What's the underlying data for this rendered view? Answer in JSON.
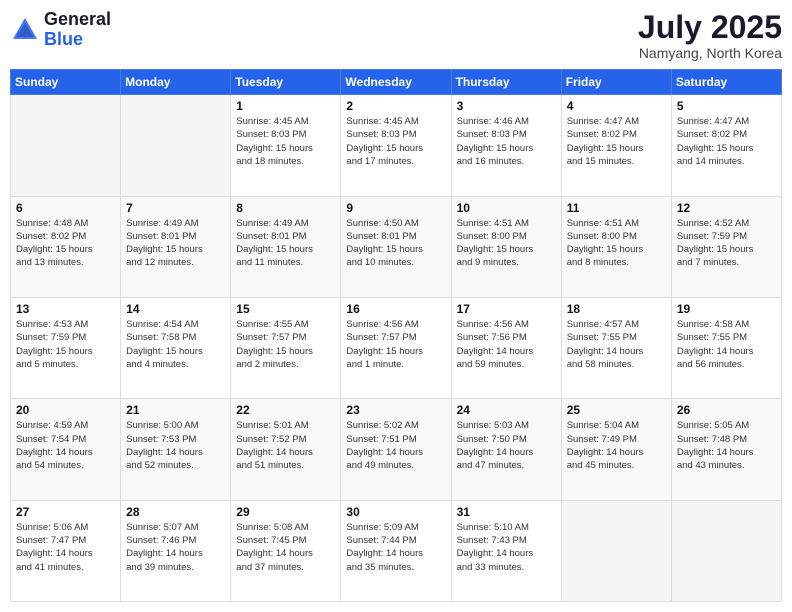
{
  "header": {
    "logo_general": "General",
    "logo_blue": "Blue",
    "month_title": "July 2025",
    "location": "Namyang, North Korea"
  },
  "weekdays": [
    "Sunday",
    "Monday",
    "Tuesday",
    "Wednesday",
    "Thursday",
    "Friday",
    "Saturday"
  ],
  "weeks": [
    [
      {
        "day": "",
        "content": ""
      },
      {
        "day": "",
        "content": ""
      },
      {
        "day": "1",
        "content": "Sunrise: 4:45 AM\nSunset: 8:03 PM\nDaylight: 15 hours\nand 18 minutes."
      },
      {
        "day": "2",
        "content": "Sunrise: 4:45 AM\nSunset: 8:03 PM\nDaylight: 15 hours\nand 17 minutes."
      },
      {
        "day": "3",
        "content": "Sunrise: 4:46 AM\nSunset: 8:03 PM\nDaylight: 15 hours\nand 16 minutes."
      },
      {
        "day": "4",
        "content": "Sunrise: 4:47 AM\nSunset: 8:02 PM\nDaylight: 15 hours\nand 15 minutes."
      },
      {
        "day": "5",
        "content": "Sunrise: 4:47 AM\nSunset: 8:02 PM\nDaylight: 15 hours\nand 14 minutes."
      }
    ],
    [
      {
        "day": "6",
        "content": "Sunrise: 4:48 AM\nSunset: 8:02 PM\nDaylight: 15 hours\nand 13 minutes."
      },
      {
        "day": "7",
        "content": "Sunrise: 4:49 AM\nSunset: 8:01 PM\nDaylight: 15 hours\nand 12 minutes."
      },
      {
        "day": "8",
        "content": "Sunrise: 4:49 AM\nSunset: 8:01 PM\nDaylight: 15 hours\nand 11 minutes."
      },
      {
        "day": "9",
        "content": "Sunrise: 4:50 AM\nSunset: 8:01 PM\nDaylight: 15 hours\nand 10 minutes."
      },
      {
        "day": "10",
        "content": "Sunrise: 4:51 AM\nSunset: 8:00 PM\nDaylight: 15 hours\nand 9 minutes."
      },
      {
        "day": "11",
        "content": "Sunrise: 4:51 AM\nSunset: 8:00 PM\nDaylight: 15 hours\nand 8 minutes."
      },
      {
        "day": "12",
        "content": "Sunrise: 4:52 AM\nSunset: 7:59 PM\nDaylight: 15 hours\nand 7 minutes."
      }
    ],
    [
      {
        "day": "13",
        "content": "Sunrise: 4:53 AM\nSunset: 7:59 PM\nDaylight: 15 hours\nand 5 minutes."
      },
      {
        "day": "14",
        "content": "Sunrise: 4:54 AM\nSunset: 7:58 PM\nDaylight: 15 hours\nand 4 minutes."
      },
      {
        "day": "15",
        "content": "Sunrise: 4:55 AM\nSunset: 7:57 PM\nDaylight: 15 hours\nand 2 minutes."
      },
      {
        "day": "16",
        "content": "Sunrise: 4:56 AM\nSunset: 7:57 PM\nDaylight: 15 hours\nand 1 minute."
      },
      {
        "day": "17",
        "content": "Sunrise: 4:56 AM\nSunset: 7:56 PM\nDaylight: 14 hours\nand 59 minutes."
      },
      {
        "day": "18",
        "content": "Sunrise: 4:57 AM\nSunset: 7:55 PM\nDaylight: 14 hours\nand 58 minutes."
      },
      {
        "day": "19",
        "content": "Sunrise: 4:58 AM\nSunset: 7:55 PM\nDaylight: 14 hours\nand 56 minutes."
      }
    ],
    [
      {
        "day": "20",
        "content": "Sunrise: 4:59 AM\nSunset: 7:54 PM\nDaylight: 14 hours\nand 54 minutes."
      },
      {
        "day": "21",
        "content": "Sunrise: 5:00 AM\nSunset: 7:53 PM\nDaylight: 14 hours\nand 52 minutes."
      },
      {
        "day": "22",
        "content": "Sunrise: 5:01 AM\nSunset: 7:52 PM\nDaylight: 14 hours\nand 51 minutes."
      },
      {
        "day": "23",
        "content": "Sunrise: 5:02 AM\nSunset: 7:51 PM\nDaylight: 14 hours\nand 49 minutes."
      },
      {
        "day": "24",
        "content": "Sunrise: 5:03 AM\nSunset: 7:50 PM\nDaylight: 14 hours\nand 47 minutes."
      },
      {
        "day": "25",
        "content": "Sunrise: 5:04 AM\nSunset: 7:49 PM\nDaylight: 14 hours\nand 45 minutes."
      },
      {
        "day": "26",
        "content": "Sunrise: 5:05 AM\nSunset: 7:48 PM\nDaylight: 14 hours\nand 43 minutes."
      }
    ],
    [
      {
        "day": "27",
        "content": "Sunrise: 5:06 AM\nSunset: 7:47 PM\nDaylight: 14 hours\nand 41 minutes."
      },
      {
        "day": "28",
        "content": "Sunrise: 5:07 AM\nSunset: 7:46 PM\nDaylight: 14 hours\nand 39 minutes."
      },
      {
        "day": "29",
        "content": "Sunrise: 5:08 AM\nSunset: 7:45 PM\nDaylight: 14 hours\nand 37 minutes."
      },
      {
        "day": "30",
        "content": "Sunrise: 5:09 AM\nSunset: 7:44 PM\nDaylight: 14 hours\nand 35 minutes."
      },
      {
        "day": "31",
        "content": "Sunrise: 5:10 AM\nSunset: 7:43 PM\nDaylight: 14 hours\nand 33 minutes."
      },
      {
        "day": "",
        "content": ""
      },
      {
        "day": "",
        "content": ""
      }
    ]
  ]
}
